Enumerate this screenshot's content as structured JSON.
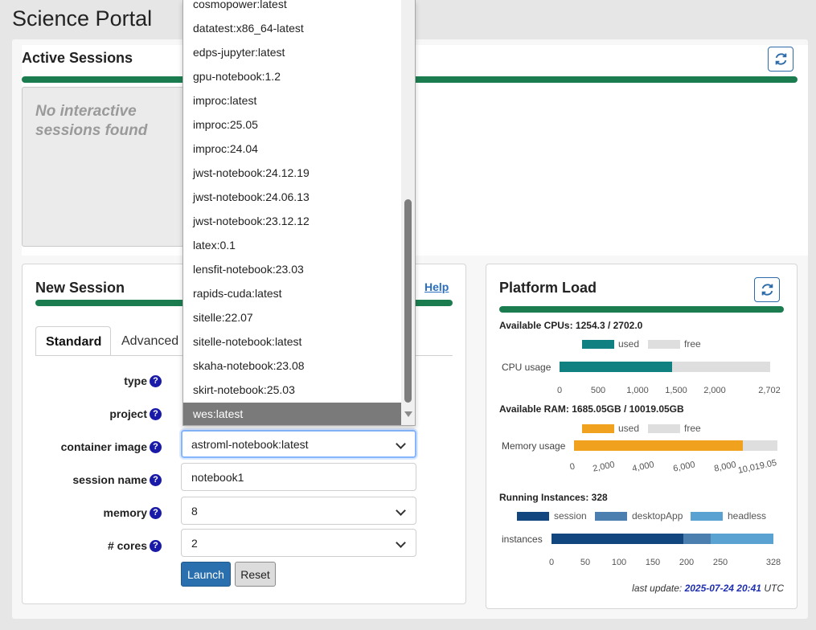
{
  "page": {
    "title": "Science Portal"
  },
  "active_sessions": {
    "title": "Active Sessions",
    "empty_message": "No interactive sessions found",
    "refresh_icon": "refresh-icon"
  },
  "new_session": {
    "title": "New Session",
    "help_label": "Help",
    "tabs": [
      {
        "label": "Standard",
        "active": true
      },
      {
        "label": "Advanced",
        "active": false
      }
    ],
    "fields": {
      "type": {
        "label": "type"
      },
      "project": {
        "label": "project"
      },
      "container_image": {
        "label": "container image",
        "value": "astroml-notebook:latest"
      },
      "session_name": {
        "label": "session name",
        "value": "notebook1"
      },
      "memory": {
        "label": "memory",
        "value": "8"
      },
      "cores": {
        "label": "# cores",
        "value": "2"
      }
    },
    "help_glyph": "?",
    "launch_label": "Launch",
    "reset_label": "Reset"
  },
  "container_dropdown": {
    "options": [
      "cosmopower:latest",
      "datatest:x86_64-latest",
      "edps-jupyter:latest",
      "gpu-notebook:1.2",
      "improc:latest",
      "improc:25.05",
      "improc:24.04",
      "jwst-notebook:24.12.19",
      "jwst-notebook:24.06.13",
      "jwst-notebook:23.12.12",
      "latex:0.1",
      "lensfit-notebook:23.03",
      "rapids-cuda:latest",
      "sitelle:22.07",
      "sitelle-notebook:latest",
      "skaha-notebook:23.08",
      "skirt-notebook:25.03",
      "wes:latest"
    ],
    "highlighted": "wes:latest"
  },
  "platform_load": {
    "title": "Platform Load",
    "cpu": {
      "heading": "Available CPUs: 1254.3 / 2702.0",
      "legend_used": "used",
      "legend_free": "free",
      "bar_label": "CPU usage",
      "used": 1447.7,
      "total": 2702,
      "ticks": [
        "0",
        "500",
        "1,000",
        "1,500",
        "2,000",
        "2,702"
      ]
    },
    "ram": {
      "heading": "Available RAM: 1685.05GB / 10019.05GB",
      "legend_used": "used",
      "legend_free": "free",
      "bar_label": "Memory usage",
      "used": 8334,
      "total": 10019.05,
      "ticks": [
        "0",
        "2,000",
        "4,000",
        "6,000",
        "8,000",
        "10,019.05"
      ]
    },
    "instances": {
      "heading": "Running Instances: 328",
      "legend": [
        "session",
        "desktopApp",
        "headless"
      ],
      "bar_label": "instances",
      "values": [
        195,
        40,
        93
      ],
      "total": 328,
      "ticks": [
        "0",
        "50",
        "100",
        "150",
        "200",
        "250",
        "328"
      ]
    },
    "last_update_prefix": "last update:",
    "last_update_value": "2025-07-24 20:41",
    "last_update_suffix": "UTC"
  },
  "colors": {
    "accent_green": "#1b7d4f",
    "cpu_used": "#118080",
    "ram_used": "#f0a21f",
    "free": "#dedede",
    "session": "#12467f",
    "desktop_app": "#4a7fb0",
    "headless": "#5aa2d2"
  }
}
